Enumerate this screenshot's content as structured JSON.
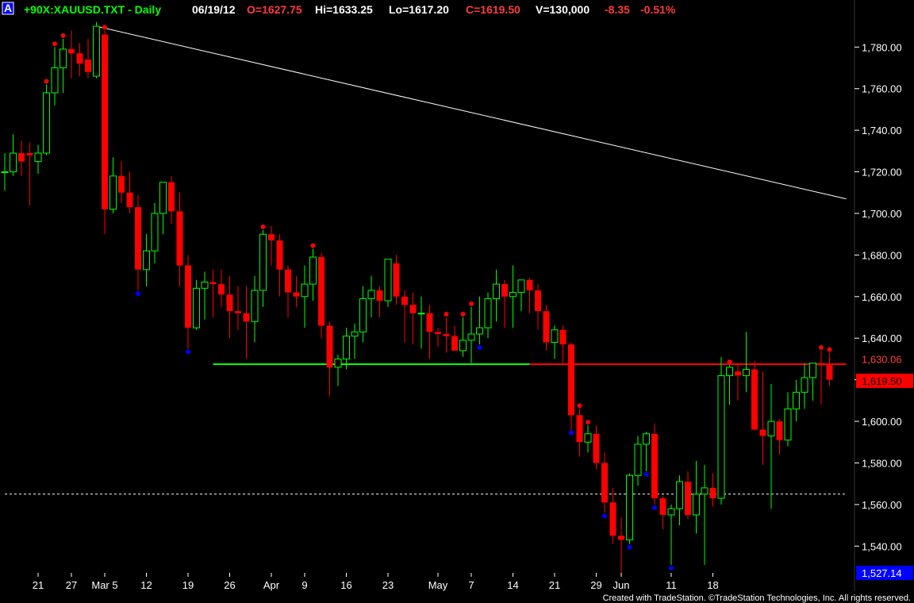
{
  "header": {
    "badge": "A",
    "symbol": "+90X:XAUUSD.TXT - Daily",
    "date": "06/19/12",
    "open": "O=1627.75",
    "high": "Hi=1633.25",
    "low": "Lo=1617.20",
    "close": "C=1619.50",
    "volume": "V=130,000",
    "change": "-8.35",
    "change_pct": "-0.51%"
  },
  "footer": {
    "credit": "Created with TradeStation. ©TradeStation Technologies, Inc. All rights reserved."
  },
  "colors": {
    "background": "#000000",
    "up": "#00ff00",
    "down": "#ff0000",
    "resistance_line": "#00ff00",
    "price_line": "#ff0000",
    "trend_line": "#ffffff",
    "swing_high": "#ff0000",
    "swing_low": "#0000ff",
    "badge": "#0000ff",
    "last_price_box": "#ff0000",
    "low_box": "#0000ff"
  },
  "chart_data": {
    "type": "candlestick",
    "title": "+90X:XAUUSD.TXT - Daily",
    "ylim": [
      1527.14,
      1795
    ],
    "y_ticks": [
      "1,540.00",
      "1,560.00",
      "1,580.00",
      "1,600.00",
      "1,620.00",
      "1,640.00",
      "1,660.00",
      "1,680.00",
      "1,700.00",
      "1,720.00",
      "1,740.00",
      "1,760.00",
      "1,780.00"
    ],
    "y_tick_values": [
      1540,
      1560,
      1580,
      1600,
      1620,
      1640,
      1660,
      1680,
      1700,
      1720,
      1740,
      1760,
      1780
    ],
    "x_labels": [
      {
        "label": "21",
        "index": 4
      },
      {
        "label": "27",
        "index": 8
      },
      {
        "label": "Mar 5",
        "index": 12
      },
      {
        "label": "12",
        "index": 17
      },
      {
        "label": "19",
        "index": 22
      },
      {
        "label": "26",
        "index": 27
      },
      {
        "label": "Apr",
        "index": 32
      },
      {
        "label": "9",
        "index": 36
      },
      {
        "label": "16",
        "index": 41
      },
      {
        "label": "23",
        "index": 46
      },
      {
        "label": "May",
        "index": 52
      },
      {
        "label": "7",
        "index": 56
      },
      {
        "label": "14",
        "index": 61
      },
      {
        "label": "21",
        "index": 66
      },
      {
        "label": "29",
        "index": 71
      },
      {
        "label": "Jun",
        "index": 74
      },
      {
        "label": "11",
        "index": 80
      },
      {
        "label": "18",
        "index": 85
      }
    ],
    "candles": [
      [
        1720,
        1729,
        1711,
        1720
      ],
      [
        1720,
        1738,
        1718,
        1729
      ],
      [
        1729,
        1735,
        1718,
        1725
      ],
      [
        1729,
        1734,
        1704,
        1728
      ],
      [
        1725,
        1733,
        1719,
        1729
      ],
      [
        1729,
        1762,
        1728,
        1758
      ],
      [
        1758,
        1780,
        1752,
        1770
      ],
      [
        1770,
        1784,
        1758,
        1779
      ],
      [
        1779,
        1788,
        1765,
        1777
      ],
      [
        1777,
        1782,
        1766,
        1772
      ],
      [
        1774,
        1784,
        1765,
        1768
      ],
      [
        1766,
        1792,
        1765,
        1790
      ],
      [
        1786,
        1788,
        1690,
        1702
      ],
      [
        1702,
        1727,
        1700,
        1718
      ],
      [
        1718,
        1725,
        1705,
        1710
      ],
      [
        1710,
        1720,
        1700,
        1703
      ],
      [
        1703,
        1709,
        1663,
        1673
      ],
      [
        1673,
        1690,
        1665,
        1682
      ],
      [
        1682,
        1705,
        1676,
        1700
      ],
      [
        1700,
        1715,
        1690,
        1715
      ],
      [
        1715,
        1718,
        1695,
        1701
      ],
      [
        1701,
        1710,
        1665,
        1675
      ],
      [
        1675,
        1680,
        1635,
        1645
      ],
      [
        1645,
        1668,
        1644,
        1664
      ],
      [
        1664,
        1672,
        1649,
        1667
      ],
      [
        1667,
        1673,
        1650,
        1666
      ],
      [
        1666,
        1673,
        1655,
        1661
      ],
      [
        1661,
        1670,
        1640,
        1653
      ],
      [
        1653,
        1665,
        1644,
        1652
      ],
      [
        1652,
        1665,
        1630,
        1648
      ],
      [
        1648,
        1670,
        1638,
        1663
      ],
      [
        1663,
        1692,
        1655,
        1690
      ],
      [
        1690,
        1694,
        1675,
        1687
      ],
      [
        1687,
        1690,
        1660,
        1673
      ],
      [
        1673,
        1675,
        1650,
        1662
      ],
      [
        1662,
        1670,
        1655,
        1660
      ],
      [
        1660,
        1675,
        1645,
        1666
      ],
      [
        1666,
        1683,
        1658,
        1679
      ],
      [
        1679,
        1681,
        1640,
        1646
      ],
      [
        1646,
        1648,
        1612,
        1626
      ],
      [
        1626,
        1632,
        1617,
        1630
      ],
      [
        1630,
        1645,
        1625,
        1641
      ],
      [
        1641,
        1647,
        1630,
        1643
      ],
      [
        1643,
        1665,
        1638,
        1659
      ],
      [
        1659,
        1670,
        1650,
        1663
      ],
      [
        1663,
        1665,
        1650,
        1658
      ],
      [
        1658,
        1672,
        1655,
        1678
      ],
      [
        1676,
        1680,
        1656,
        1660
      ],
      [
        1660,
        1663,
        1638,
        1656
      ],
      [
        1656,
        1662,
        1637,
        1652
      ],
      [
        1652,
        1660,
        1635,
        1652
      ],
      [
        1652,
        1656,
        1630,
        1643
      ],
      [
        1643,
        1645,
        1636,
        1642
      ],
      [
        1642,
        1650,
        1633,
        1641
      ],
      [
        1641,
        1646,
        1635,
        1634
      ],
      [
        1634,
        1650,
        1631,
        1639
      ],
      [
        1639,
        1655,
        1628,
        1642
      ],
      [
        1642,
        1660,
        1637,
        1645
      ],
      [
        1645,
        1662,
        1640,
        1659
      ],
      [
        1659,
        1673,
        1648,
        1666
      ],
      [
        1666,
        1668,
        1645,
        1660
      ],
      [
        1660,
        1675,
        1645,
        1662
      ],
      [
        1662,
        1668,
        1653,
        1668
      ],
      [
        1668,
        1669,
        1652,
        1663
      ],
      [
        1663,
        1666,
        1644,
        1653
      ],
      [
        1653,
        1656,
        1634,
        1638
      ],
      [
        1638,
        1646,
        1630,
        1644
      ],
      [
        1644,
        1646,
        1628,
        1637
      ],
      [
        1637,
        1638,
        1596,
        1603
      ],
      [
        1603,
        1606,
        1583,
        1590
      ],
      [
        1590,
        1598,
        1585,
        1594
      ],
      [
        1594,
        1598,
        1577,
        1580
      ],
      [
        1580,
        1585,
        1556,
        1561
      ],
      [
        1561,
        1568,
        1541,
        1545
      ],
      [
        1545,
        1554,
        1527,
        1543
      ],
      [
        1543,
        1575,
        1541,
        1574
      ],
      [
        1574,
        1593,
        1569,
        1589
      ],
      [
        1589,
        1595,
        1576,
        1594
      ],
      [
        1594,
        1599,
        1560,
        1563
      ],
      [
        1563,
        1564,
        1548,
        1555
      ],
      [
        1555,
        1560,
        1531,
        1558
      ],
      [
        1558,
        1574,
        1550,
        1571
      ],
      [
        1571,
        1576,
        1553,
        1555
      ],
      [
        1555,
        1581,
        1546,
        1565
      ],
      [
        1565,
        1579,
        1531,
        1568
      ],
      [
        1568,
        1575,
        1559,
        1563
      ],
      [
        1563,
        1631,
        1560,
        1622
      ],
      [
        1622,
        1627,
        1608,
        1626
      ],
      [
        1624,
        1628,
        1610,
        1622
      ],
      [
        1622,
        1643,
        1614,
        1625
      ],
      [
        1625,
        1629,
        1596,
        1596
      ],
      [
        1596,
        1624,
        1579,
        1593
      ],
      [
        1593,
        1618,
        1558,
        1600
      ],
      [
        1600,
        1601,
        1584,
        1591
      ],
      [
        1591,
        1614,
        1588,
        1606
      ],
      [
        1606,
        1620,
        1600,
        1614
      ],
      [
        1614,
        1628,
        1606,
        1621
      ],
      [
        1621,
        1627,
        1610,
        1628
      ],
      [
        1628,
        1634,
        1608,
        1627
      ],
      [
        1627,
        1633,
        1617,
        1620
      ]
    ],
    "swing_highs": [
      5,
      6,
      7,
      12,
      31,
      37,
      53,
      55,
      56,
      69,
      70,
      87,
      98,
      99
    ],
    "swing_lows": [
      16,
      22,
      57,
      68,
      72,
      75,
      77,
      78,
      80
    ],
    "horizontal_lines": [
      {
        "name": "support-resistance",
        "value": 1627.5,
        "from_index": 25,
        "to_index": 63,
        "color": "#00ff00"
      },
      {
        "name": "current-level",
        "value": 1627.5,
        "from_index": 63,
        "to_index": 101,
        "color": "#ff0000"
      },
      {
        "name": "dotted-level",
        "value": 1565,
        "from_index": 0,
        "to_index": 101,
        "color": "#ffffff"
      }
    ],
    "trend_line": {
      "from": {
        "index": 11,
        "value": 1790
      },
      "to": {
        "index": 101,
        "value": 1707
      }
    },
    "price_labels": [
      {
        "name": "level-label",
        "text": "1,630.06",
        "value": 1630.06
      },
      {
        "name": "last-price-label",
        "text": "1,619.50",
        "value": 1619.5
      },
      {
        "name": "low-label",
        "text": "1,527.14",
        "value": 1527.14
      }
    ]
  }
}
